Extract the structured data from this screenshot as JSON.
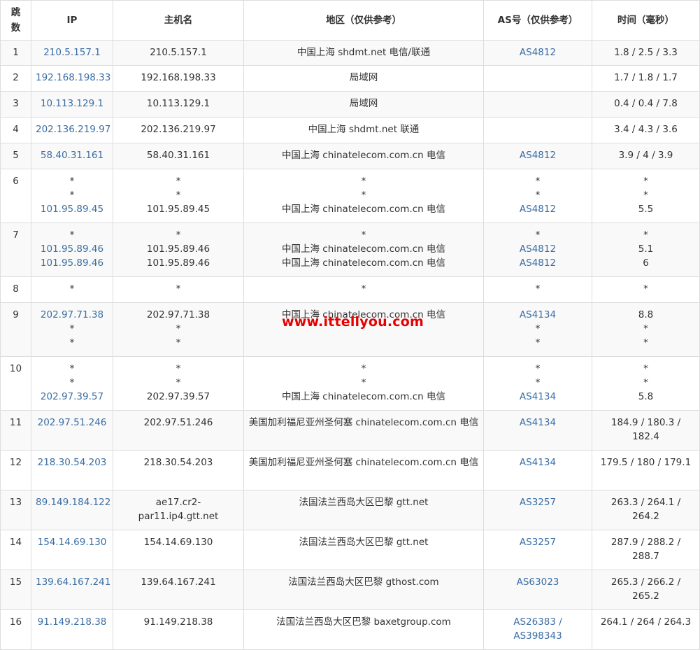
{
  "headers": {
    "hop": "跳\n数",
    "ip": "IP",
    "host": "主机名",
    "region": "地区（仅供参考）",
    "as": "AS号（仅供参考）",
    "time": "时间（毫秒）"
  },
  "rows": [
    {
      "hop": "1",
      "ip": [
        "210.5.157.1"
      ],
      "host": [
        "210.5.157.1"
      ],
      "region": [
        "中国上海 shdmt.net 电信/联通"
      ],
      "as": [
        "AS4812"
      ],
      "time": [
        "1.8 / 2.5 / 3.3"
      ]
    },
    {
      "hop": "2",
      "ip": [
        "192.168.198.33"
      ],
      "host": [
        "192.168.198.33"
      ],
      "region": [
        "局域网"
      ],
      "as": [
        ""
      ],
      "time": [
        "1.7 / 1.8 / 1.7"
      ]
    },
    {
      "hop": "3",
      "ip": [
        "10.113.129.1"
      ],
      "host": [
        "10.113.129.1"
      ],
      "region": [
        "局域网"
      ],
      "as": [
        ""
      ],
      "time": [
        "0.4 / 0.4 / 7.8"
      ]
    },
    {
      "hop": "4",
      "ip": [
        "202.136.219.97"
      ],
      "host": [
        "202.136.219.97"
      ],
      "region": [
        "中国上海 shdmt.net 联通"
      ],
      "as": [
        ""
      ],
      "time": [
        "3.4 / 4.3 / 3.6"
      ]
    },
    {
      "hop": "5",
      "ip": [
        "58.40.31.161"
      ],
      "host": [
        "58.40.31.161"
      ],
      "region": [
        "中国上海 chinatelecom.com.cn 电信"
      ],
      "as": [
        "AS4812"
      ],
      "time": [
        "3.9 / 4 / 3.9"
      ]
    },
    {
      "hop": "6",
      "ip": [
        "*",
        "*",
        "101.95.89.45"
      ],
      "host": [
        "*",
        "*",
        "101.95.89.45"
      ],
      "region": [
        "*",
        "*",
        "中国上海 chinatelecom.com.cn 电信"
      ],
      "as": [
        "*",
        "*",
        "AS4812"
      ],
      "time": [
        "*",
        "*",
        "5.5"
      ]
    },
    {
      "hop": "7",
      "ip": [
        "*",
        "101.95.89.46",
        "101.95.89.46"
      ],
      "host": [
        "*",
        "101.95.89.46",
        "101.95.89.46"
      ],
      "region": [
        "*",
        "中国上海 chinatelecom.com.cn 电信",
        "中国上海 chinatelecom.com.cn 电信"
      ],
      "as": [
        "*",
        "AS4812",
        "AS4812"
      ],
      "time": [
        "*",
        "5.1",
        "6"
      ]
    },
    {
      "hop": "8",
      "ip": [
        "*"
      ],
      "host": [
        "*"
      ],
      "region": [
        "*"
      ],
      "as": [
        "*"
      ],
      "time": [
        "*"
      ]
    },
    {
      "hop": "9",
      "ip": [
        "202.97.71.38",
        "*",
        "*"
      ],
      "host": [
        "202.97.71.38",
        "*",
        "*"
      ],
      "region": [
        "中国上海 chinatelecom.com.cn 电信",
        "",
        ""
      ],
      "as": [
        "AS4134",
        "*",
        "*"
      ],
      "time": [
        "8.8",
        "*",
        "*"
      ]
    },
    {
      "hop": "10",
      "ip": [
        "*",
        "*",
        "202.97.39.57"
      ],
      "host": [
        "*",
        "*",
        "202.97.39.57"
      ],
      "region": [
        "*",
        "*",
        "中国上海 chinatelecom.com.cn 电信"
      ],
      "as": [
        "*",
        "*",
        "AS4134"
      ],
      "time": [
        "*",
        "*",
        "5.8"
      ]
    },
    {
      "hop": "11",
      "ip": [
        "202.97.51.246"
      ],
      "host": [
        "202.97.51.246"
      ],
      "region": [
        "美国加利福尼亚州圣何塞 chinatelecom.com.cn 电信"
      ],
      "as": [
        "AS4134"
      ],
      "time": [
        "184.9 / 180.3 / 182.4"
      ]
    },
    {
      "hop": "12",
      "ip": [
        "218.30.54.203"
      ],
      "host": [
        "218.30.54.203"
      ],
      "region": [
        "美国加利福尼亚州圣何塞 chinatelecom.com.cn 电信"
      ],
      "as": [
        "AS4134"
      ],
      "time": [
        "179.5 / 180 / 179.1"
      ]
    },
    {
      "hop": "13",
      "ip": [
        "89.149.184.122"
      ],
      "host": [
        "ae17.cr2-par11.ip4.gtt.net"
      ],
      "region": [
        "法国法兰西岛大区巴黎 gtt.net"
      ],
      "as": [
        "AS3257"
      ],
      "time": [
        "263.3 / 264.1 / 264.2"
      ]
    },
    {
      "hop": "14",
      "ip": [
        "154.14.69.130"
      ],
      "host": [
        "154.14.69.130"
      ],
      "region": [
        "法国法兰西岛大区巴黎 gtt.net"
      ],
      "as": [
        "AS3257"
      ],
      "time": [
        "287.9 / 288.2 / 288.7"
      ]
    },
    {
      "hop": "15",
      "ip": [
        "139.64.167.241"
      ],
      "host": [
        "139.64.167.241"
      ],
      "region": [
        "法国法兰西岛大区巴黎 gthost.com"
      ],
      "as": [
        "AS63023"
      ],
      "time": [
        "265.3 / 266.2 / 265.2"
      ]
    },
    {
      "hop": "16",
      "ip": [
        "91.149.218.38"
      ],
      "host": [
        "91.149.218.38"
      ],
      "region": [
        "法国法兰西岛大区巴黎 baxetgroup.com"
      ],
      "as": [
        "AS26383 /",
        "AS398343"
      ],
      "time": [
        "264.1 / 264 / 264.3"
      ]
    }
  ],
  "watermark": "www.ittellyou.com",
  "colors": {
    "link": "#3a6ea5",
    "border": "#dddddd",
    "alt_row": "#f9f9f9",
    "watermark": "#e60000"
  }
}
